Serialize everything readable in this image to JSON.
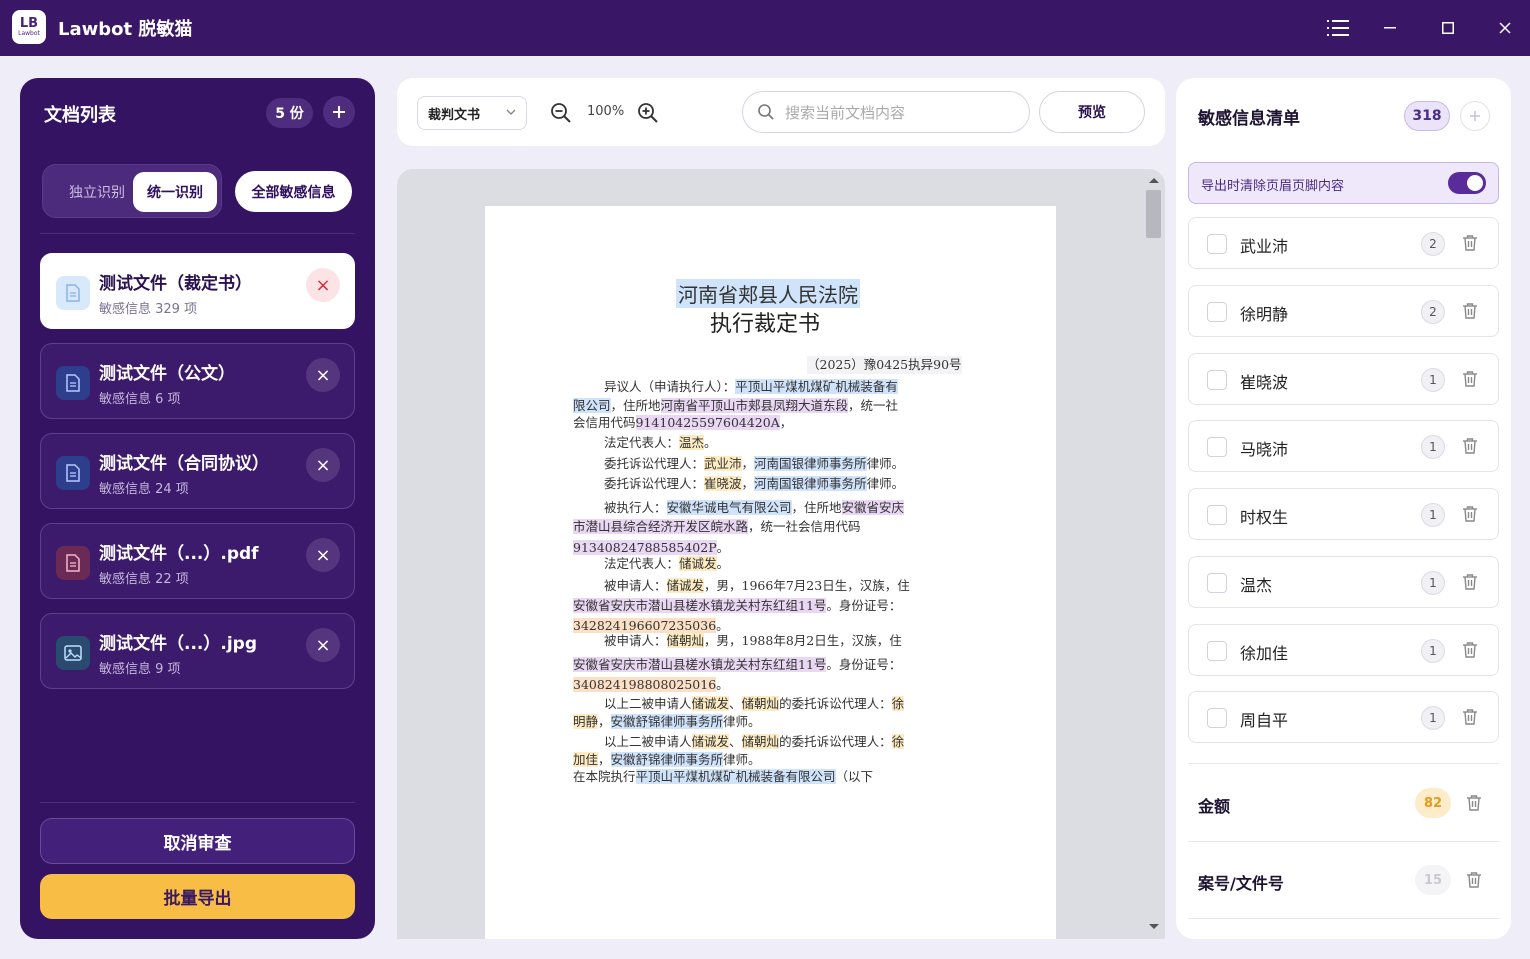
{
  "app": {
    "title": "Lawbot 脱敏猫",
    "logo_main": "LB",
    "logo_sub": "Lawbot"
  },
  "left": {
    "title": "文档列表",
    "count": "5 份",
    "seg": {
      "independent": "独立识别",
      "unified": "统一识别"
    },
    "all_sensitive": "全部敏感信息",
    "docs": [
      {
        "name": "测试文件（裁定书）",
        "sub": "敏感信息 329 项",
        "icon": "document-icon",
        "active": true
      },
      {
        "name": "测试文件（公文）",
        "sub": "敏感信息 6 项",
        "icon": "document-icon"
      },
      {
        "name": "测试文件（合同协议）",
        "sub": "敏感信息 24 项",
        "icon": "document-icon"
      },
      {
        "name": "测试文件（...）.pdf",
        "sub": "敏感信息 22 项",
        "icon": "pdf-icon"
      },
      {
        "name": "测试文件（...）.jpg",
        "sub": "敏感信息 9 项",
        "icon": "image-icon"
      }
    ],
    "cancel": "取消审查",
    "export": "批量导出"
  },
  "toolbar": {
    "doc_type": "裁判文书",
    "zoom": "100%",
    "search_placeholder": "搜索当前文档内容",
    "preview": "预览"
  },
  "paper": {
    "court": "河南省郏县人民法院",
    "title": "执行裁定书",
    "case_no": "（2025）豫0425执异90号",
    "lines": {
      "l1a": "异议人（申请执行人）：",
      "l1b": "平顶山平煤机煤矿机械装备有",
      "l2a": "限公司",
      "l2b": "，住所地",
      "l2c": "河南省平顶山市郏县凤翔大道东段",
      "l2d": "，统一社",
      "l3a": "会信用代码",
      "l3b": "91410425597604420A",
      "l3c": "，",
      "l4a": "法定代表人：",
      "l4b": "温杰",
      "l4c": "。",
      "l5a": "委托诉讼代理人：",
      "l5b": "武业沛",
      "l5c": "，",
      "l5d": "河南国银律师事务所",
      "l5e": "律师。",
      "l6a": "委托诉讼代理人：",
      "l6b": "崔晓波",
      "l6c": "，",
      "l6d": "河南国银律师事务所",
      "l6e": "律师。",
      "l7a": "被执行人：",
      "l7b": "安徽华诚电气有限公司",
      "l7c": "，住所地",
      "l7d": "安徽省安庆",
      "l8a": "市潜山县综合经济开发区皖水路",
      "l8b": "，统一社会信用代码",
      "l9a": "913408247885854­02P",
      "l9b": "。",
      "l10a": "法定代表人：",
      "l10b": "储诚发",
      "l10c": "。",
      "l11a": "被申请人：",
      "l11b": "储诚发",
      "l11c": "，男，1966年7月23日生，汉族，住",
      "l12a": "安徽省安庆市潜山县槎水镇龙关村东红组11号",
      "l12b": "。身份证号：",
      "l13a": "342824196607235036",
      "l13b": "。",
      "l14a": "被申请人：",
      "l14b": "储朝灿",
      "l14c": "，男，1988年8月2日生，汉族，住",
      "l15a": "安徽省安庆市潜山县槎水镇龙关村东红组11号",
      "l15b": "。身份证号：",
      "l16a": "340824198808025016",
      "l16b": "。",
      "l17a": "以上二被申请人",
      "l17b": "储诚发",
      "l17c": "、",
      "l17d": "储朝灿",
      "l17e": "的委托诉讼代理人：",
      "l17f": "徐",
      "l18a": "明静",
      "l18b": "，",
      "l18c": "安徽舒锦律师事务所",
      "l18d": "律师。",
      "l19a": "以上二被申请人",
      "l19b": "储诚发",
      "l19c": "、",
      "l19d": "储朝灿",
      "l19e": "的委托诉讼代理人：",
      "l19f": "徐",
      "l20a": "加佳",
      "l20b": "，",
      "l20c": "安徽舒锦律师事务所",
      "l20d": "律师。",
      "l21a": "在本院执行",
      "l21b": "平顶山平煤机煤矿机械装备有限公司",
      "l21c": "（以下"
    }
  },
  "right": {
    "title": "敏感信息清单",
    "count": "318",
    "toggle_label": "导出时清除页眉页脚内容",
    "toggle_on": true,
    "people": [
      {
        "name": "武业沛",
        "count": "2"
      },
      {
        "name": "徐明静",
        "count": "2"
      },
      {
        "name": "崔晓波",
        "count": "1"
      },
      {
        "name": "马晓沛",
        "count": "1"
      },
      {
        "name": "时权生",
        "count": "1"
      },
      {
        "name": "温杰",
        "count": "1"
      },
      {
        "name": "徐加佳",
        "count": "1"
      },
      {
        "name": "周自平",
        "count": "1"
      }
    ],
    "categories": [
      {
        "title": "金额",
        "count": "82"
      },
      {
        "title": "案号/文件号",
        "count": "15"
      }
    ]
  },
  "colors": {
    "brand": "#3a1766",
    "accent": "#f7bd44",
    "highlight_org": "#cfe3fb",
    "highlight_addr": "#ead7f3",
    "highlight_name": "#fdecc2"
  }
}
